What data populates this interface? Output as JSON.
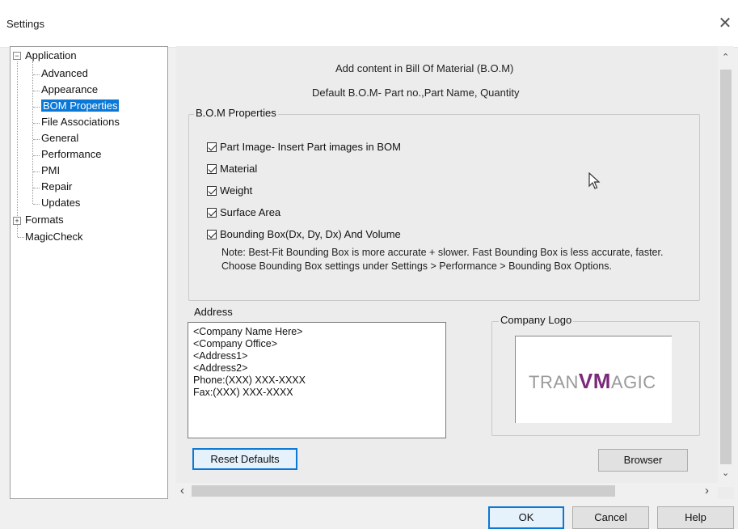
{
  "window": {
    "title": "Settings",
    "close_symbol": "✕"
  },
  "tree": {
    "application": "Application",
    "children": [
      "Advanced",
      "Appearance",
      "BOM Properties",
      "File Associations",
      "General",
      "Performance",
      "PMI",
      "Repair",
      "Updates"
    ],
    "formats": "Formats",
    "magiccheck": "MagicCheck",
    "expand_minus": "−",
    "expand_plus": "+"
  },
  "content": {
    "heading1": "Add content in Bill Of Material (B.O.M)",
    "heading2": "Default B.O.M- Part no.,Part Name, Quantity",
    "bom_group_title": "B.O.M Properties",
    "checkboxes": [
      {
        "label": "Part Image- Insert Part images in BOM",
        "checked": true
      },
      {
        "label": "Material",
        "checked": true
      },
      {
        "label": "Weight",
        "checked": true
      },
      {
        "label": "Surface Area",
        "checked": true
      },
      {
        "label": "Bounding Box(Dx, Dy, Dx) And Volume",
        "checked": true
      }
    ],
    "note": "Note: Best-Fit Bounding Box is more accurate + slower. Fast Bounding Box is less accurate, faster. Choose Bounding Box settings under Settings > Performance > Bounding Box Options.",
    "address_title": "Address",
    "address_text": "<Company Name Here>\n<Company Office>\n<Address1>\n<Address2>\nPhone:(XXX) XXX-XXXX\nFax:(XXX) XXX-XXXX",
    "logo_title": "Company Logo",
    "logo_text_left": "TRAN",
    "logo_text_mid": "VM",
    "logo_text_right": "AGIC",
    "reset_button": "Reset Defaults",
    "browser_button": "Browser"
  },
  "footer": {
    "ok": "OK",
    "cancel": "Cancel",
    "help": "Help"
  },
  "scroll": {
    "up": "⌃",
    "down": "⌄",
    "left": "‹",
    "right": "›"
  },
  "colors": {
    "selection": "#0a78d7",
    "logo_accent": "#7a2a7a"
  }
}
